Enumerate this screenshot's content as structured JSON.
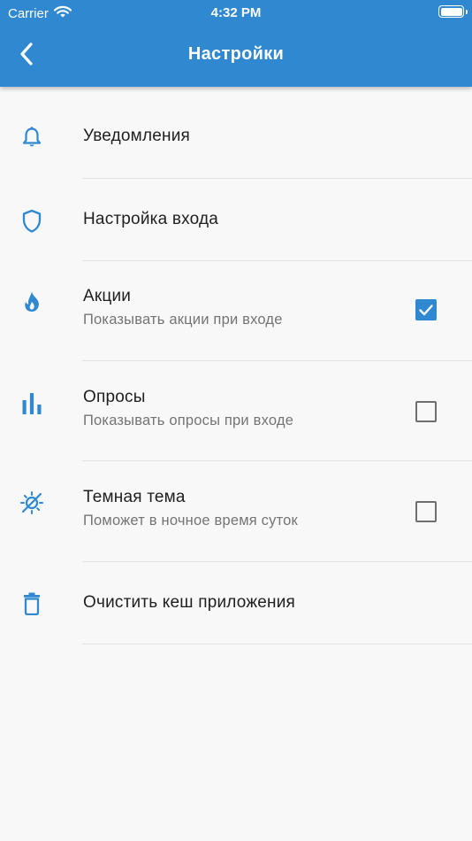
{
  "status_bar": {
    "carrier": "Carrier",
    "time": "4:32 PM"
  },
  "header": {
    "title": "Настройки",
    "back_icon": "chevron-left-icon"
  },
  "colors": {
    "primary": "#2f88d0",
    "background": "#f8f8f8",
    "divider": "#e2e2e2",
    "title_text": "#1f1f1f",
    "subtitle_text": "#747474"
  },
  "settings": {
    "items": [
      {
        "icon": "bell-icon",
        "title": "Уведомления"
      },
      {
        "icon": "shield-icon",
        "title": "Настройка входа"
      },
      {
        "icon": "fire-icon",
        "title": "Акции",
        "subtitle": "Показывать акции при входе",
        "checked": true
      },
      {
        "icon": "bar-chart-icon",
        "title": "Опросы",
        "subtitle": "Показывать опросы при входе",
        "checked": false
      },
      {
        "icon": "dark-theme-icon",
        "title": "Темная тема",
        "subtitle": "Поможет в ночное время суток",
        "checked": false
      },
      {
        "icon": "trash-icon",
        "title": "Очистить кеш приложения"
      }
    ]
  }
}
